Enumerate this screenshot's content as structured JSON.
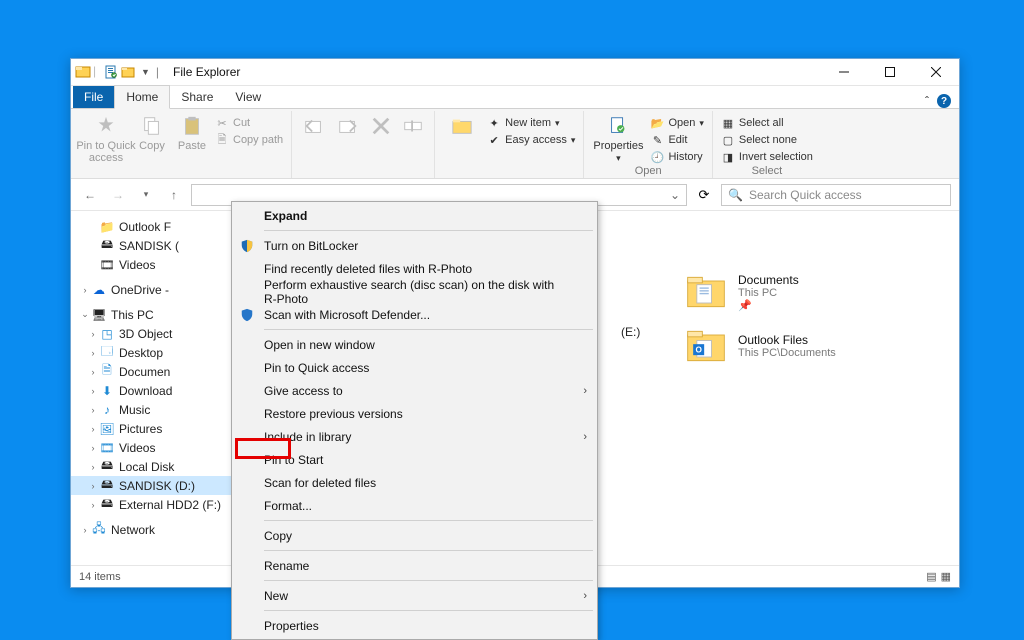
{
  "title": "File Explorer",
  "tabs": {
    "file": "File",
    "home": "Home",
    "share": "Share",
    "view": "View"
  },
  "ribbon": {
    "pin": "Pin to Quick\naccess",
    "copy": "Copy",
    "paste": "Paste",
    "cut": "Cut",
    "copypath": "Copy path",
    "newitem": "New item",
    "easyaccess": "Easy access",
    "properties": "Properties",
    "open": "Open",
    "edit": "Edit",
    "history": "History",
    "open_group": "Open",
    "selectall": "Select all",
    "selectnone": "Select none",
    "invert": "Invert selection",
    "select_group": "Select"
  },
  "nav": {
    "refresh": "⟳",
    "search_placeholder": "Search Quick access"
  },
  "sidebar": {
    "outlook": "Outlook F",
    "sandisk_top": "SANDISK (",
    "videos_top": "Videos",
    "onedrive": "OneDrive -",
    "thispc": "This PC",
    "obj3d": "3D Object",
    "desktop": "Desktop",
    "documents": "Documen",
    "downloads": "Download",
    "music": "Music",
    "pictures": "Pictures",
    "videos": "Videos",
    "localdisk": "Local Disk",
    "sandisk_sel": "SANDISK (D:)",
    "exthdd": "External HDD2 (F:)",
    "network": "Network"
  },
  "ctx": {
    "expand": "Expand",
    "bitlocker": "Turn on BitLocker",
    "rphoto": "Find recently deleted files with R-Photo",
    "rstudio": "Perform exhaustive search (disc scan) on the disk with R-Photo",
    "defender": "Scan with Microsoft Defender...",
    "newwin": "Open in new window",
    "pinqa": "Pin to Quick access",
    "giveaccess": "Give access to",
    "restore": "Restore previous versions",
    "include": "Include in library",
    "pinstart": "Pin to Start",
    "scandeleted": "Scan for deleted files",
    "format": "Format...",
    "copy": "Copy",
    "rename": "Rename",
    "new": "New",
    "properties": "Properties"
  },
  "main": {
    "drive_short": "(E:)",
    "docs": "Documents",
    "docs_sub": "This PC",
    "outlook": "Outlook Files",
    "outlook_sub": "This PC\\Documents"
  },
  "status": {
    "items": "14 items"
  }
}
